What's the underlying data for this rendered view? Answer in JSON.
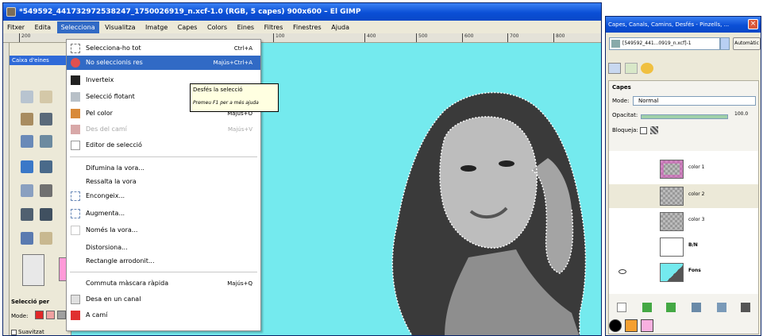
{
  "window": {
    "title": "*549592_441732972538247_1750026919_n.xcf-1.0 (RGB, 5 capes) 900x600 – El GIMP"
  },
  "menubar": [
    "Fitxer",
    "Edita",
    "Selecciona",
    "Visualitza",
    "Imatge",
    "Capes",
    "Colors",
    "Eines",
    "Filtres",
    "Finestres",
    "Ajuda"
  ],
  "ruler": {
    "ticks": [
      "200",
      "100",
      "400",
      "500",
      "600",
      "700",
      "800"
    ]
  },
  "selection_menu": {
    "items": [
      {
        "label": "Selecciona-ho tot",
        "shortcut": "Ctrl+A"
      },
      {
        "label": "No seleccionis res",
        "shortcut": "Majús+Ctrl+A"
      },
      {
        "label": "Inverteix",
        "shortcut": ""
      },
      {
        "label": "Selecció flotant",
        "shortcut": ""
      },
      {
        "label": "Pel color",
        "shortcut": "Majús+O"
      },
      {
        "label": "Des del camí",
        "shortcut": "Majús+V"
      },
      {
        "label": "Editor de selecció",
        "shortcut": ""
      },
      {
        "label": "Difumina la vora...",
        "shortcut": ""
      },
      {
        "label": "Ressalta la vora",
        "shortcut": ""
      },
      {
        "label": "Encongeix...",
        "shortcut": ""
      },
      {
        "label": "Augmenta...",
        "shortcut": ""
      },
      {
        "label": "Només la vora...",
        "shortcut": ""
      },
      {
        "label": "Distorsiona...",
        "shortcut": ""
      },
      {
        "label": "Rectangle arrodonit...",
        "shortcut": ""
      },
      {
        "label": "Commuta màscara ràpida",
        "shortcut": "Majús+Q"
      },
      {
        "label": "Desa en un canal",
        "shortcut": ""
      },
      {
        "label": "A camí",
        "shortcut": ""
      }
    ]
  },
  "tooltip": {
    "line1": "Desfés la selecció",
    "line2": "Premeu F1 per a més ajuda"
  },
  "toolbox": {
    "title": "Caixa d'eines",
    "options_title": "Selecció per",
    "mode_label": "Mode:",
    "antialias_label": "Suavitzat"
  },
  "dock": {
    "title": "Capes, Canals, Camins, Desfés - Pinzells, ...",
    "image_selector": "[549592_441...0919_n.xcf]-1",
    "auto_button": "Automàtic",
    "panel_title": "Capes",
    "mode_label": "Mode:",
    "mode_value": "Normal",
    "opacity_label": "Opacitat:",
    "opacity_value": "100.0",
    "opacity_fraction": 1.0,
    "lock_label": "Bloqueja:",
    "layers": [
      {
        "name": "color 1",
        "selected": false,
        "visible": false
      },
      {
        "name": "color 2",
        "selected": true,
        "visible": false
      },
      {
        "name": "color 3",
        "selected": false,
        "visible": false
      },
      {
        "name": "B/N",
        "selected": false,
        "visible": false
      },
      {
        "name": "Fons",
        "selected": false,
        "visible": true
      }
    ]
  },
  "colors": {
    "canvas_bg": "#74eaee",
    "titlebar": "#0b4fd6",
    "menu_highlight": "#316ac5"
  }
}
